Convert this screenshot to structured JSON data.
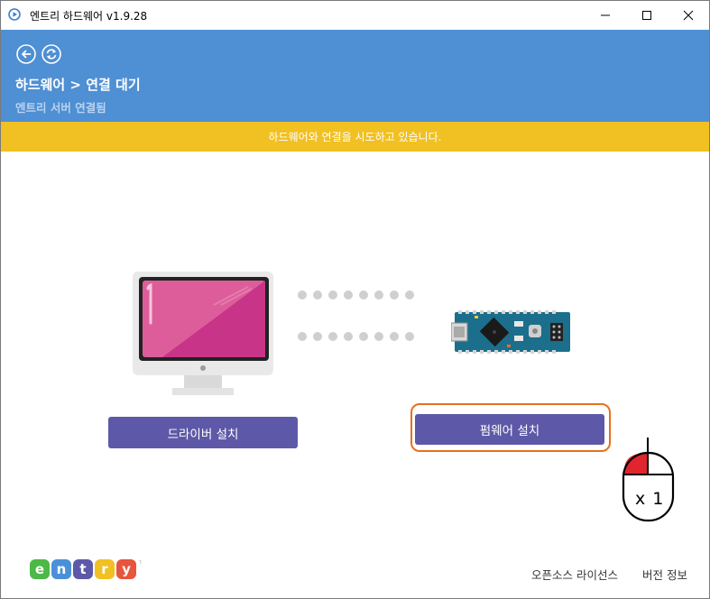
{
  "window": {
    "title": "엔트리 하드웨어 v1.9.28"
  },
  "header": {
    "breadcrumb": "하드웨어 > 연결 대기",
    "status": "엔트리 서버 연결됨"
  },
  "banner": {
    "message": "하드웨어와 연결을 시도하고 있습니다."
  },
  "buttons": {
    "driver_install": "드라이버 설치",
    "firmware_install": "펌웨어 설치"
  },
  "mouse_hint": {
    "label": "x 1"
  },
  "footer": {
    "license": "오픈소스 라이선스",
    "version_info": "버전 정보",
    "logo_letters": [
      "e",
      "n",
      "t",
      "r",
      "y"
    ],
    "logo_colors": [
      "#4cb847",
      "#4a90d9",
      "#5d59a8",
      "#f1c022",
      "#e8543c"
    ]
  },
  "icons": {
    "app": "play-circle-icon",
    "back": "back-arrow-icon",
    "refresh": "refresh-icon"
  },
  "colors": {
    "header": "#4f8fd3",
    "banner": "#f1c022",
    "button": "#5d59a8",
    "highlight": "#e8701e"
  }
}
